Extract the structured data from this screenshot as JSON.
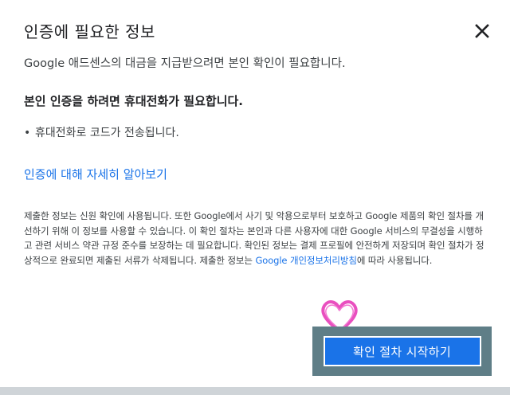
{
  "dialog": {
    "title": "인증에 필요한 정보",
    "close_icon": "close-icon",
    "intro": "Google 애드센스의 대금을 지급받으려면 본인 확인이 필요합니다.",
    "heading": "본인 인증을 하려면 휴대전화가 필요합니다.",
    "bullets": [
      "휴대전화로 코드가 전송됩니다."
    ],
    "learn_more": "인증에 대해 자세히 알아보기",
    "notice_text": "제출한 정보는 신원 확인에 사용됩니다. 또한 Google에서 사기 및 악용으로부터 보호하고 Google 제품의 확인 절차를 개선하기 위해 이 정보를 사용할 수 있습니다. 이 확인 절차는 본인과 다른 사용자에 대한 Google 서비스의 무결성을 시행하고 관련 서비스 약관 규정 준수를 보장하는 데 필요합니다. 확인된 정보는 결제 프로필에 안전하게 저장되며 확인 절차가 정상적으로 완료되면 제출된 서류가 삭제됩니다. 제출한 정보는 ",
    "privacy_link": "Google 개인정보처리방침",
    "notice_suffix": "에 따라 사용됩니다.",
    "start_button": "확인 절차 시작하기"
  },
  "colors": {
    "accent": "#1a73e8",
    "highlight_frame": "#5f7e87",
    "heart": "#e94fbf"
  }
}
